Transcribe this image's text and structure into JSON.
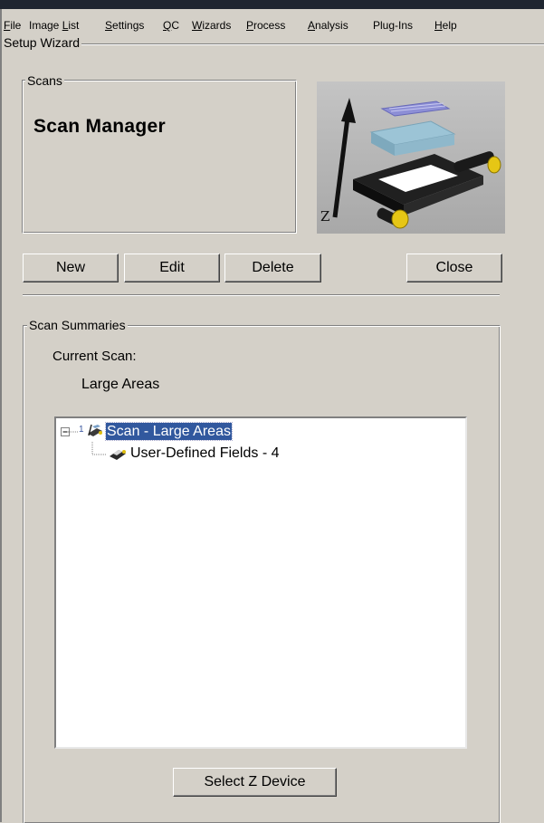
{
  "menu": {
    "items": [
      {
        "pre": "",
        "key": "F",
        "post": "ile"
      },
      {
        "pre": "Image ",
        "key": "L",
        "post": "ist"
      },
      {
        "pre": "",
        "key": "S",
        "post": "ettings"
      },
      {
        "pre": "",
        "key": "Q",
        "post": "C"
      },
      {
        "pre": "",
        "key": "W",
        "post": "izards"
      },
      {
        "pre": "",
        "key": "P",
        "post": "rocess"
      },
      {
        "pre": "",
        "key": "A",
        "post": "nalysis"
      },
      {
        "pre": "Plu",
        "key": "g",
        "post": "-Ins"
      },
      {
        "pre": "",
        "key": "H",
        "post": "elp"
      }
    ]
  },
  "wizard": {
    "title": "Setup Wizard",
    "scans_group_label": "Scans",
    "scan_manager_title": "Scan Manager",
    "image": {
      "axis_label": "Z",
      "icon": "z-stage-illustration"
    }
  },
  "buttons": {
    "new": "New",
    "edit": "Edit",
    "delete": "Delete",
    "close": "Close",
    "select_z_device": "Select Z Device"
  },
  "summaries": {
    "group_label": "Scan Summaries",
    "current_scan_label": "Current Scan:",
    "current_scan_value": "Large Areas",
    "tree": {
      "root": {
        "label": "Scan - Large Areas",
        "expander": "⊟",
        "badge": "1",
        "icon": "scan-icon",
        "selected": true
      },
      "children": [
        {
          "label": "User-Defined Fields - 4",
          "icon": "fields-icon"
        }
      ]
    }
  },
  "colors": {
    "face": "#d4d0c8",
    "selection": "#31589e",
    "titlebar": "#1f2530"
  }
}
